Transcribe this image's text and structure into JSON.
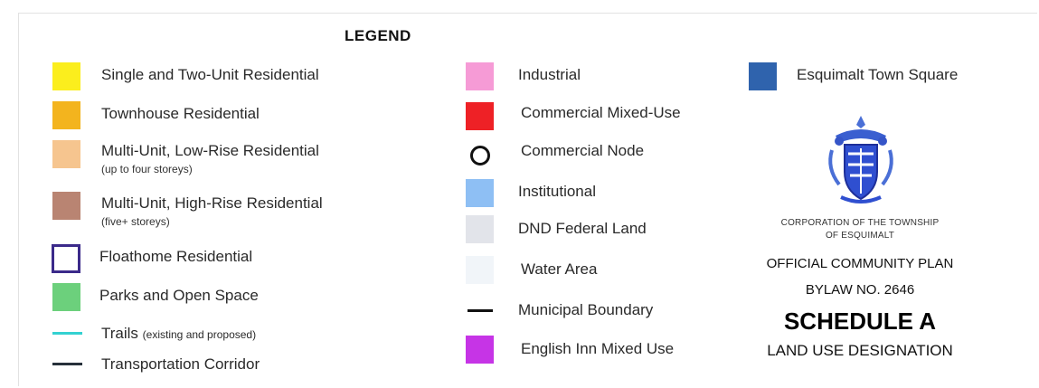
{
  "legend": {
    "title": "LEGEND",
    "column1": [
      {
        "label": "Single and Two-Unit Residential",
        "color": "#fbee1d"
      },
      {
        "label": "Townhouse Residential",
        "color": "#f3b41e"
      },
      {
        "label": "Multi-Unit, Low-Rise Residential",
        "sub": "(up to four storeys)",
        "color": "#f6c58f"
      },
      {
        "label": "Multi-Unit, High-Rise Residential",
        "sub": "(five+ storeys)",
        "color": "#b98472"
      },
      {
        "label": "Floathome Residential",
        "color": "#3b2a8a",
        "symbol": "outline-square"
      },
      {
        "label": "Parks and Open Space",
        "color": "#6cd07c"
      },
      {
        "label": "Trails",
        "note": "(existing and proposed)",
        "color": "#33d1d1",
        "symbol": "line"
      },
      {
        "label": "Transportation Corridor",
        "color": "#26303a",
        "symbol": "line"
      }
    ],
    "column2": [
      {
        "label": "Industrial",
        "color": "#f69bd6"
      },
      {
        "label": "Commercial Mixed-Use",
        "color": "#ee2126"
      },
      {
        "label": "Commercial Node",
        "color": "#111111",
        "symbol": "circle"
      },
      {
        "label": "Institutional",
        "color": "#8ebff4"
      },
      {
        "label": "DND Federal Land",
        "color": "#e2e4ea"
      },
      {
        "label": "Water Area",
        "color": "#f1f5f9"
      },
      {
        "label": "Municipal Boundary",
        "color": "#111111",
        "symbol": "line"
      },
      {
        "label": "English Inn Mixed Use",
        "color": "#c634e6"
      }
    ],
    "column3": [
      {
        "label": "Esquimalt Town Square",
        "color": "#2f63ad"
      }
    ]
  },
  "crest": {
    "corporation_line1": "CORPORATION OF THE TOWNSHIP",
    "corporation_line2": "OF ESQUIMALT",
    "plan": "OFFICIAL COMMUNITY PLAN",
    "bylaw": "BYLAW NO. 2646",
    "schedule": "SCHEDULE A",
    "designation": "LAND USE DESIGNATION"
  }
}
